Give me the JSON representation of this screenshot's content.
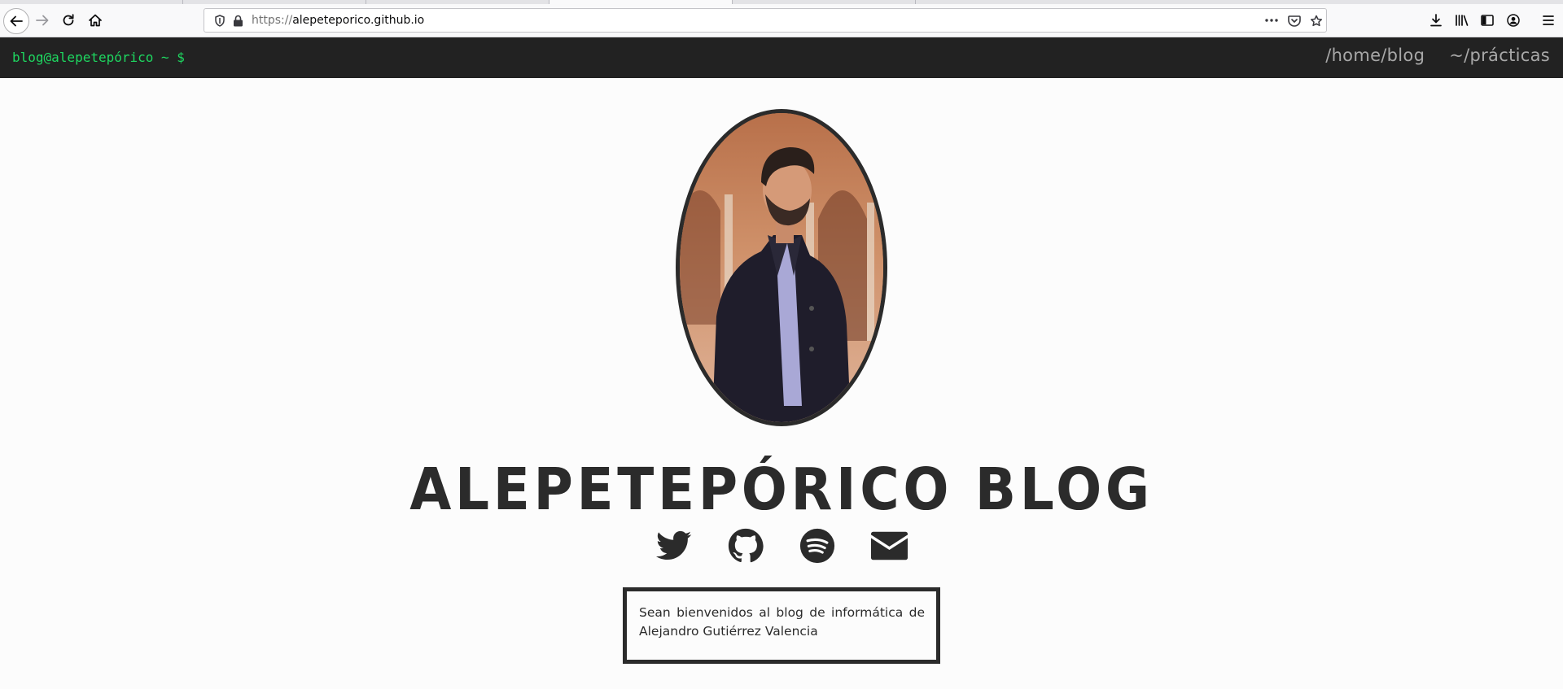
{
  "browser": {
    "url_scheme": "https://",
    "url_host": "alepeteporico.github.io"
  },
  "site": {
    "prompt": "blog@alepetepórico ~ $",
    "nav": [
      {
        "label": "/home/blog"
      },
      {
        "label": "~/prácticas"
      }
    ],
    "title": "ALEPETEPÓRICO BLOG",
    "social_icons": [
      "twitter-icon",
      "github-icon",
      "spotify-icon",
      "mail-icon"
    ],
    "welcome": "Sean bienvenidos al blog de informática de Alejandro Gutiérrez Valencia"
  },
  "colors": {
    "header_bg": "#222222",
    "prompt_green": "#1ed760",
    "nav_text": "#a8a8a8",
    "page_bg": "#fcfcfc",
    "ink": "#2b2b2b"
  }
}
